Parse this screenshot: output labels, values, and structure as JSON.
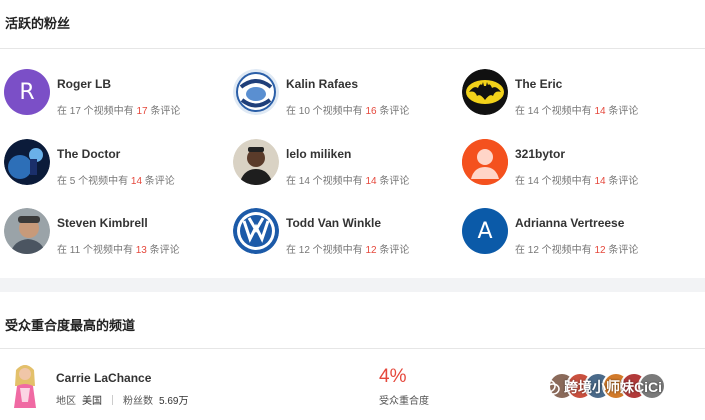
{
  "active_fans": {
    "title": "活跃的粉丝",
    "items": [
      {
        "name": "Roger LB",
        "pre": "在 ",
        "videos": "17",
        "mid": " 个视频中有 ",
        "comments": "17",
        "post": " 条评论",
        "avatar_type": "letter",
        "avatar_letter": "R",
        "avatar_color": "#7b4fc7"
      },
      {
        "name": "Kalin Rafaes",
        "pre": "在 ",
        "videos": "10",
        "mid": " 个视频中有 ",
        "comments": "16",
        "post": " 条评论",
        "avatar_type": "logo",
        "avatar_text": "CAROLINA TAR HEELS"
      },
      {
        "name": "The Eric",
        "pre": "在 ",
        "videos": "14",
        "mid": " 个视频中有 ",
        "comments": "14",
        "post": " 条评论",
        "avatar_type": "batman"
      },
      {
        "name": "The Doctor",
        "pre": "在 ",
        "videos": "5",
        "mid": " 个视频中有 ",
        "comments": "14",
        "post": " 条评论",
        "avatar_type": "space"
      },
      {
        "name": "lelo miliken",
        "pre": "在 ",
        "videos": "14",
        "mid": " 个视频中有 ",
        "comments": "14",
        "post": " 条评论",
        "avatar_type": "photo"
      },
      {
        "name": "321bytor",
        "pre": "在 ",
        "videos": "14",
        "mid": " 个视频中有 ",
        "comments": "14",
        "post": " 条评论",
        "avatar_type": "person",
        "avatar_color": "#f4511e"
      },
      {
        "name": "Steven Kimbrell",
        "pre": "在 ",
        "videos": "11",
        "mid": " 个视频中有 ",
        "comments": "13",
        "post": " 条评论",
        "avatar_type": "photo2"
      },
      {
        "name": "Todd Van Winkle",
        "pre": "在 ",
        "videos": "12",
        "mid": " 个视频中有 ",
        "comments": "12",
        "post": " 条评论",
        "avatar_type": "vw"
      },
      {
        "name": "Adrianna Vertreese",
        "pre": "在 ",
        "videos": "12",
        "mid": " 个视频中有 ",
        "comments": "12",
        "post": " 条评论",
        "avatar_type": "letter",
        "avatar_letter": "A",
        "avatar_color": "#0b5aa8"
      }
    ]
  },
  "overlap_channels": {
    "title": "受众重合度最高的频道",
    "channel": {
      "name": "Carrie LaChance",
      "region_label": "地区",
      "region_value": "美国",
      "fans_label": "粉丝数",
      "fans_value": "5.69万",
      "overlap_value": "4%",
      "overlap_label": "受众重合度"
    }
  },
  "watermark": {
    "text": "跨境小师妹CiCi"
  },
  "colors": {
    "accent_red": "#e5483c"
  }
}
